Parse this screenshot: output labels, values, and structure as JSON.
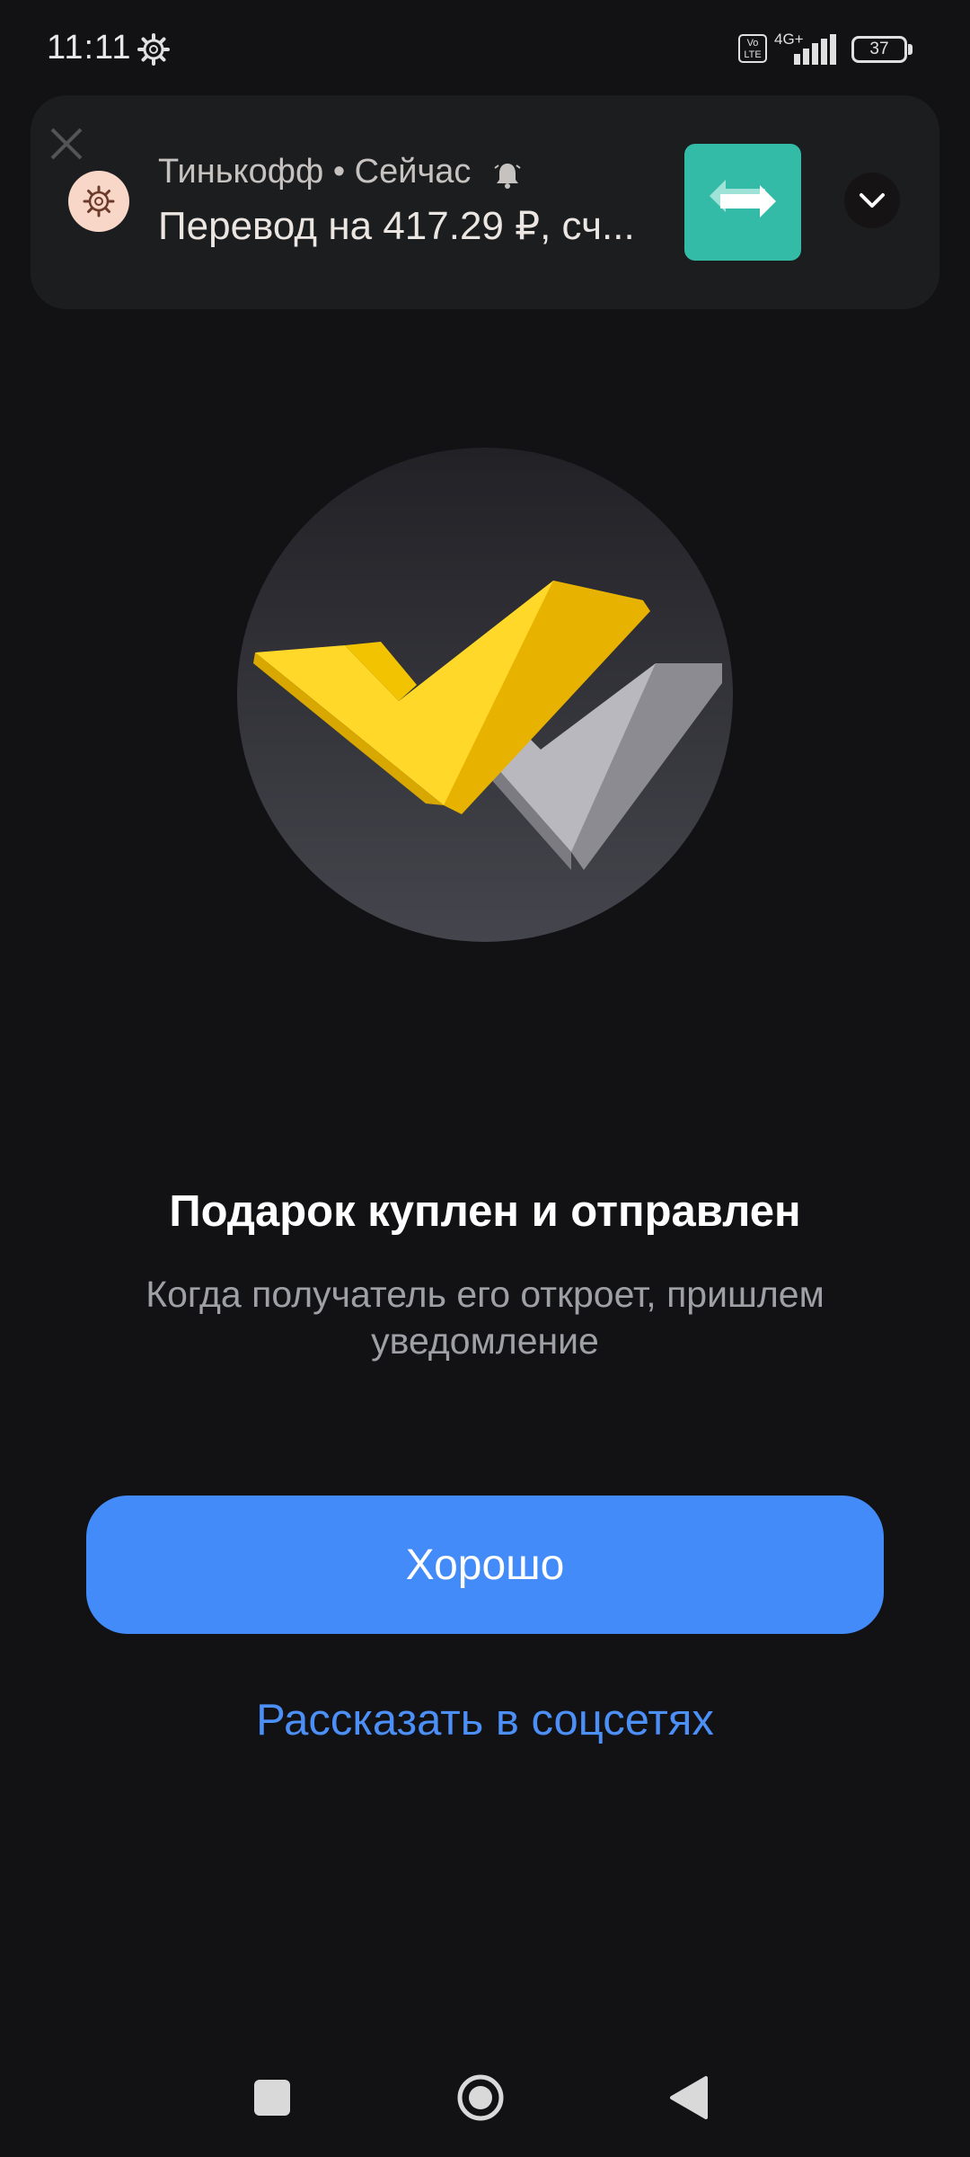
{
  "status_bar": {
    "time": "11:11",
    "volte": "Vo LTE",
    "network": "4G+",
    "battery": "37"
  },
  "notification": {
    "app_line": "Тинькофф • Сейчас",
    "text": "Перевод на 417.29 ₽, сч...",
    "icons": [
      "close-icon",
      "app-icon",
      "bell-icon",
      "transfer-icon",
      "chevron-down-icon"
    ]
  },
  "hero": {
    "icon": "double-checkmark-icon",
    "colors": {
      "primary_check": "#FFD82A",
      "secondary_check": "#B9B8BF",
      "circle": "#38383E"
    }
  },
  "main": {
    "title": "Подарок куплен и отправлен",
    "subtitle": "Когда получатель его откроет, пришлем уведомление",
    "ok_button": "Хорошо",
    "share_link": "Рассказать в соцсетях"
  },
  "colors": {
    "background": "#121214",
    "accent": "#428BF9",
    "link": "#4B8FF7"
  },
  "nav_bar": {
    "icons": [
      "recents-icon",
      "home-icon",
      "back-icon"
    ]
  }
}
